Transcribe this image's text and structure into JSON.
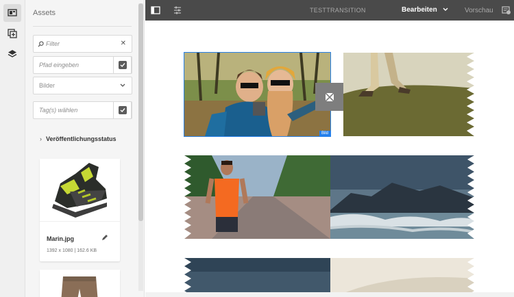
{
  "rail": {
    "items": [
      {
        "icon": "asset-browser-icon",
        "active": true
      },
      {
        "icon": "components-icon",
        "active": false
      },
      {
        "icon": "layers-icon",
        "active": false
      }
    ]
  },
  "panel": {
    "title": "Assets",
    "filter_placeholder": "Filter",
    "path_placeholder": "Pfad eingeben",
    "type_select_value": "Bilder",
    "tags_placeholder": "Tag(s) wählen",
    "publication_status_label": "Veröffentlichungsstatus",
    "assets": [
      {
        "name": "Marin.jpg",
        "meta": "1392 x 1080 | 162.6 KB"
      },
      {
        "name": "",
        "meta": ""
      }
    ]
  },
  "toolbar": {
    "page_title": "TESTTRANSITION",
    "mode_label": "Bearbeiten",
    "preview_label": "Vorschau"
  },
  "canvas": {
    "selected_label": "Bild"
  },
  "colors": {
    "accent": "#2680eb",
    "toolbar_bg": "#4a4a4a"
  }
}
